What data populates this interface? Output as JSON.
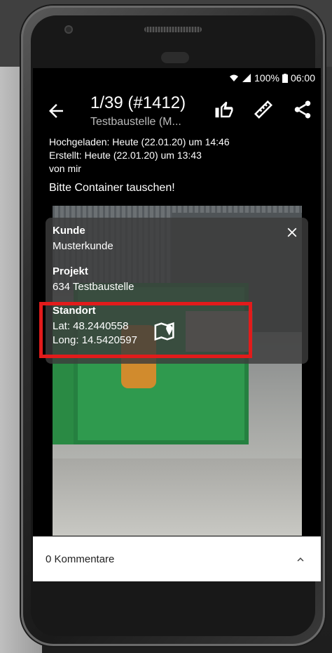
{
  "status": {
    "battery": "100%",
    "time": "06:00"
  },
  "appbar": {
    "title": "1/39 (#1412)",
    "subtitle": "Testbaustelle (M..."
  },
  "meta": {
    "uploaded": "Hochgeladen: Heute (22.01.20) um 14:46",
    "created": "Erstellt: Heute (22.01.20) um 13:43",
    "by": "von mir"
  },
  "message": "Bitte Container tauschen!",
  "details": {
    "customer_label": "Kunde",
    "customer_value": "Musterkunde",
    "project_label": "Projekt",
    "project_value": "634 Testbaustelle",
    "location_label": "Standort",
    "lat": "Lat: 48.2440558",
    "long": "Long: 14.5420597"
  },
  "comments": {
    "label": "0 Kommentare"
  },
  "colors": {
    "highlight": "#e21b1b",
    "container": "#2f9a4e",
    "accent_orange": "#e3892a"
  }
}
